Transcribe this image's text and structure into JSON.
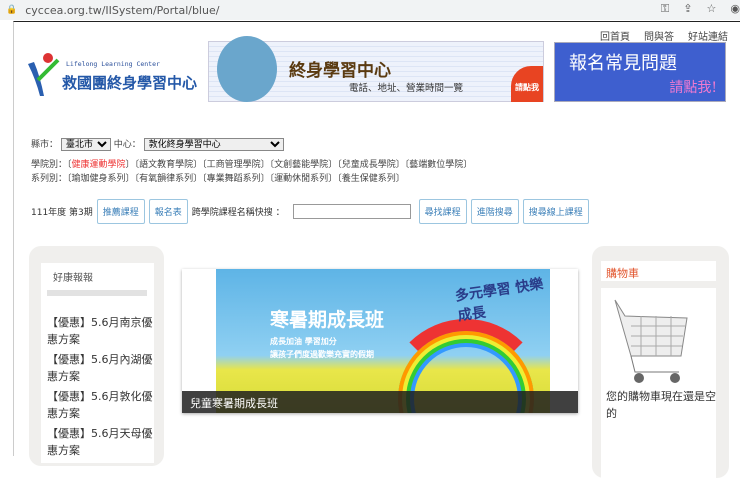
{
  "browser": {
    "url": "cyccea.org.tw/IISystem/Portal/blue/"
  },
  "header": {
    "links": [
      "回首頁",
      "問與答",
      "好站連結"
    ],
    "logo_en": "Lifelong Learning Center",
    "logo_zh": "救國團終身學習中心",
    "banner1": {
      "title": "終身學習中心",
      "subtitle": "電話、地址、營業時間一覽",
      "cta": "請點我"
    },
    "banner2": {
      "title": "報名常見問題",
      "cta": "請點我!"
    }
  },
  "filters": {
    "city_label": "縣市：",
    "city_value": "臺北市",
    "center_label": "中心：",
    "center_value": "敦化終身學習中心"
  },
  "colleges": {
    "label": "學院別：",
    "items": [
      "健康運動學院",
      "語文教育學院",
      "工商管理學院",
      "文創藝能學院",
      "兒童成長學院",
      "藝端數位學院"
    ]
  },
  "series": {
    "label": "系列別：",
    "items": [
      "瑜珈健身系列",
      "有氧韻律系列",
      "專業舞蹈系列",
      "運動休閒系列",
      "養生保健系列"
    ]
  },
  "search": {
    "term": "111年度 第3期",
    "recommend": "推薦課程",
    "form": "報名表",
    "quick_label": "跨學院課程名稱快搜 ：",
    "query": "",
    "find": "尋找課程",
    "advanced": "進階搜尋",
    "online": "搜尋線上課程"
  },
  "deals": {
    "title": "好康報報",
    "items": [
      "【優惠】5.6月南京優惠方案",
      "【優惠】5.6月內湖優惠方案",
      "【優惠】5.6月敦化優惠方案",
      "【優惠】5.6月天母優惠方案"
    ]
  },
  "slide": {
    "title": "寒暑期成長班",
    "sub1": "成長加油 學習加分",
    "sub2": "讓孩子們度過歡樂充實的假期",
    "badge": "多元學習 快樂成長",
    "caption": "兒童寒暑期成長班"
  },
  "cart": {
    "title": "購物車",
    "empty": "您的購物車現在還是空的"
  }
}
